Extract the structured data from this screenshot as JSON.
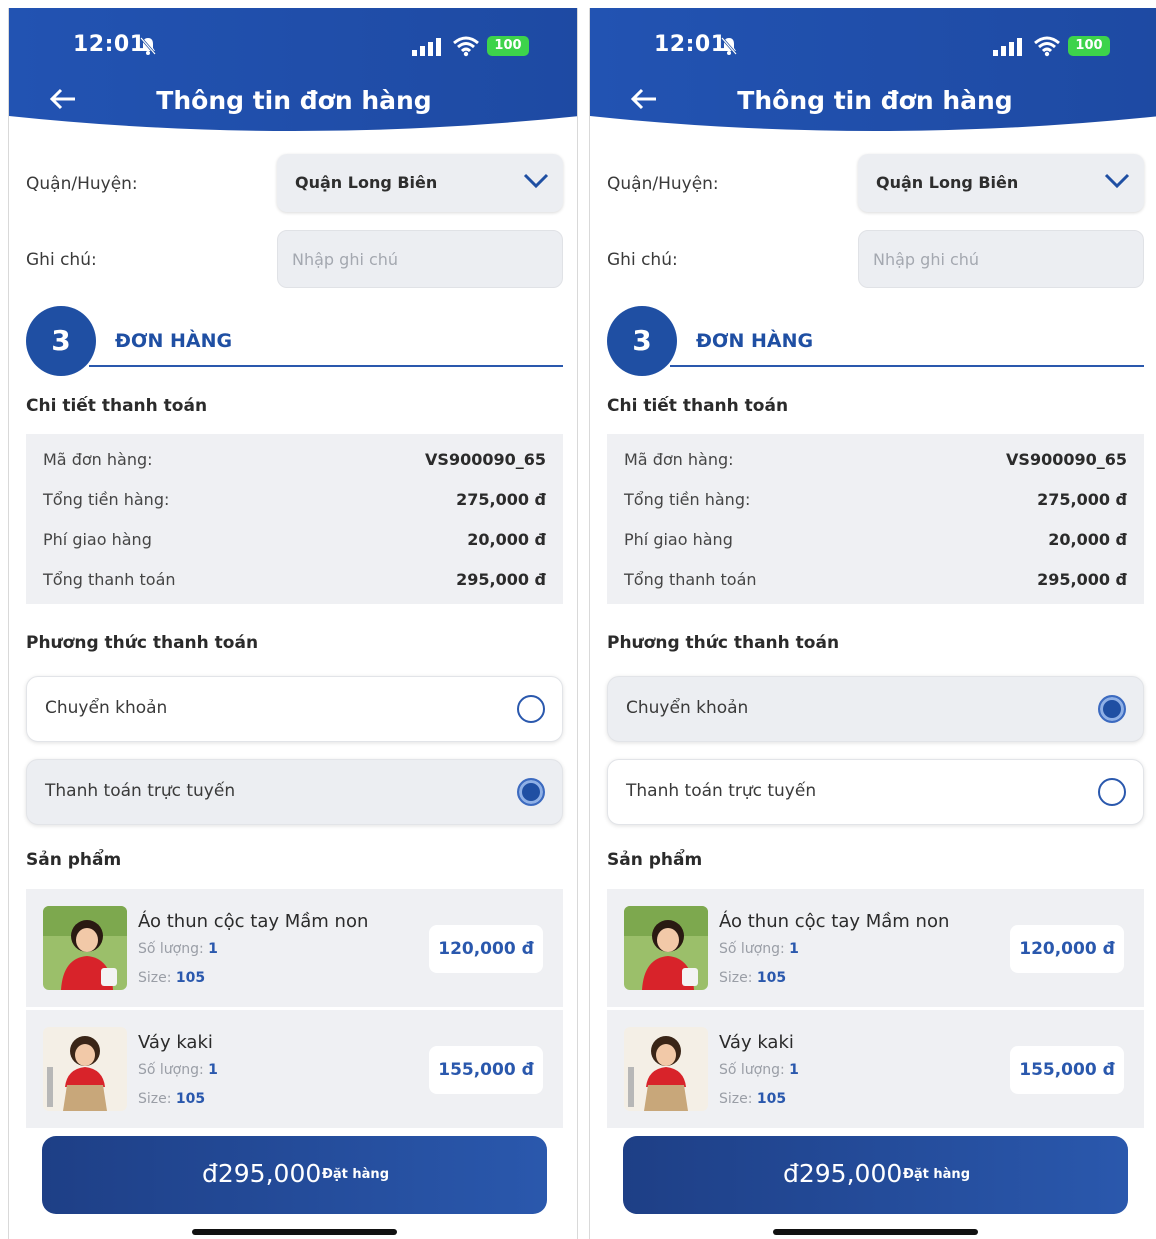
{
  "status_bar": {
    "time": "12:01",
    "battery": "100"
  },
  "header": {
    "title": "Thông tin đơn hàng"
  },
  "form": {
    "district_label": "Quận/Huyện:",
    "district_value": "Quận Long Biên",
    "note_label": "Ghi chú:",
    "note_placeholder": "Nhập ghi chú"
  },
  "step": {
    "number": "3",
    "title": "ĐƠN HÀNG"
  },
  "payment_details": {
    "title": "Chi tiết thanh toán",
    "rows": [
      {
        "label": "Mã đơn hàng:",
        "value": "VS900090_65"
      },
      {
        "label": "Tổng tiền hàng:",
        "value": "275,000 đ"
      },
      {
        "label": "Phí giao hàng",
        "value": "20,000 đ"
      },
      {
        "label": "Tổng thanh toán",
        "value": "295,000 đ"
      }
    ]
  },
  "payment_method": {
    "title": "Phương thức thanh toán",
    "options": [
      {
        "label": "Chuyển khoản"
      },
      {
        "label": "Thanh toán trực tuyến"
      }
    ],
    "screens": [
      {
        "selected": "Thanh toán trực tuyến"
      },
      {
        "selected": "Chuyển khoản"
      }
    ]
  },
  "products": {
    "title": "Sản phẩm",
    "quantity_label": "Số lượng:",
    "size_label": "Size:",
    "items": [
      {
        "name": "Áo thun cộc tay Mầm non",
        "quantity": "1",
        "size": "105",
        "price": "120,000 đ"
      },
      {
        "name": "Váy kaki",
        "quantity": "1",
        "size": "105",
        "price": "155,000 đ"
      }
    ]
  },
  "order_button": {
    "amount": "đ295,000",
    "label": "Đặt hàng"
  },
  "colors": {
    "primary": "#1f4fa3",
    "primary_dark": "#1e3f86",
    "panel": "#eff0f3",
    "battery": "#3dd34b"
  },
  "icons": [
    "back-arrow-icon",
    "chevron-down-icon",
    "bell-muted-icon",
    "signal-icon",
    "wifi-icon",
    "battery-icon",
    "radio-icon"
  ]
}
